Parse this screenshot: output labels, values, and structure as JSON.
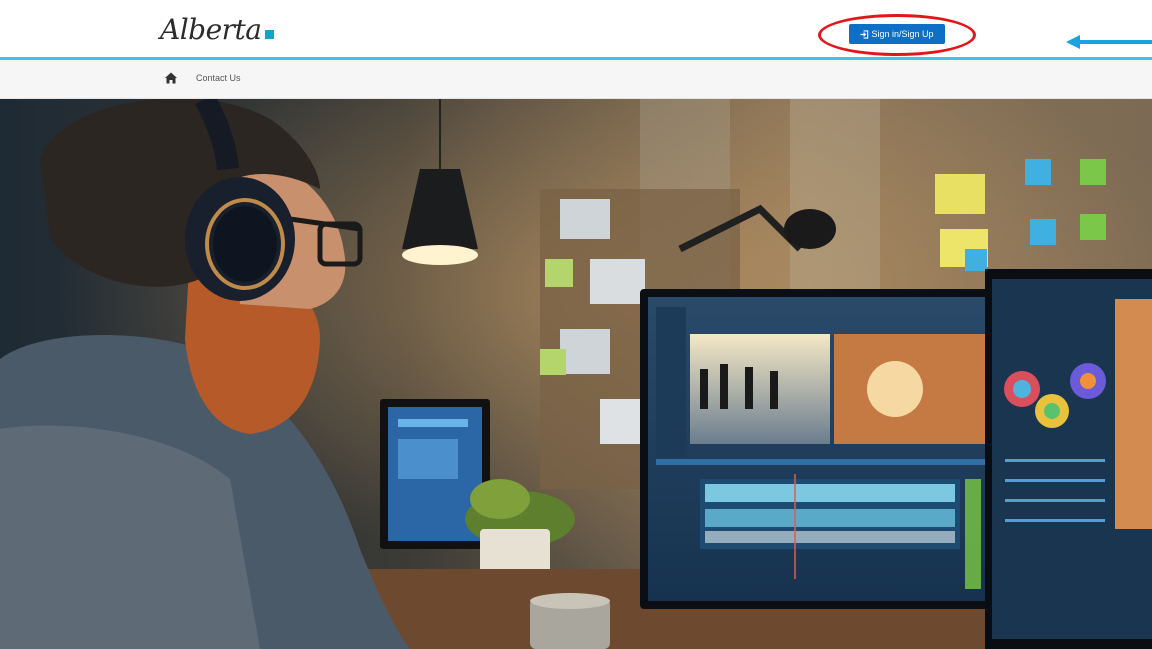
{
  "header": {
    "logo_text": "Alberta",
    "signin_label": "Sign in/Sign Up"
  },
  "nav": {
    "contact_label": "Contact Us"
  },
  "colors": {
    "accent_line": "#46c1e6",
    "button_blue": "#0d6fc6",
    "annotation_red": "#e3151a",
    "arrow_blue": "#1aa3e0"
  },
  "icons": {
    "home": "home-icon",
    "signin": "sign-in-icon"
  }
}
